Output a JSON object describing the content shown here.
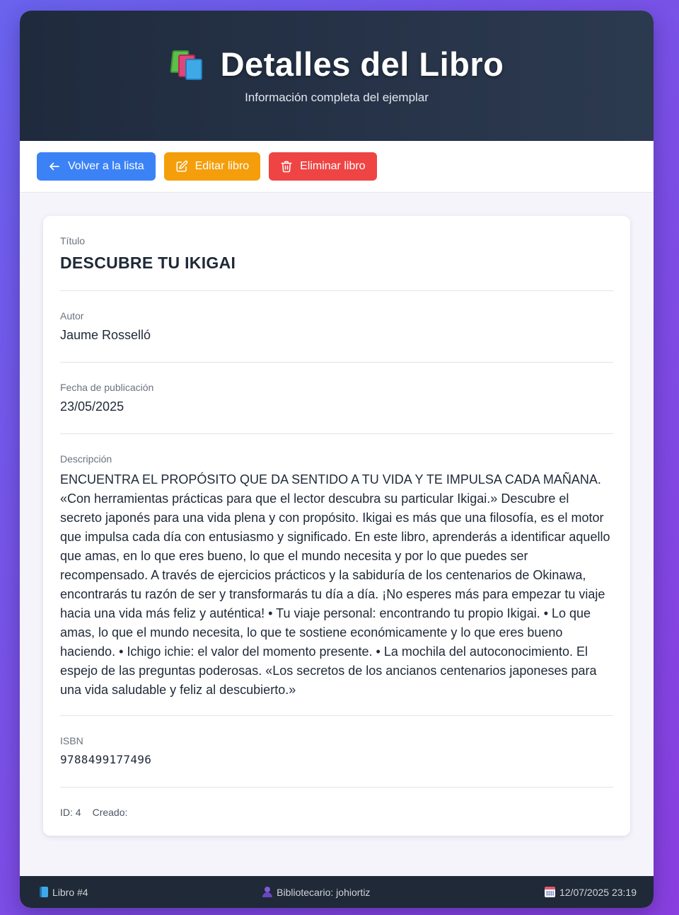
{
  "header": {
    "title": "Detalles del Libro",
    "subtitle": "Información completa del ejemplar",
    "icon": "books-icon"
  },
  "toolbar": {
    "back_label": "Volver a la lista",
    "edit_label": "Editar libro",
    "delete_label": "Eliminar libro",
    "colors": {
      "back": "#3b82f6",
      "edit": "#f59e0b",
      "delete": "#ef4444"
    }
  },
  "book": {
    "title_label": "Título",
    "title": "DESCUBRE TU IKIGAI",
    "author_label": "Autor",
    "author": "Jaume Rosselló",
    "date_label": "Fecha de publicación",
    "date": "23/05/2025",
    "description_label": "Descripción",
    "description": "ENCUENTRA EL PROPÓSITO QUE DA SENTIDO A TU VIDA Y TE IMPULSA CADA MAÑANA. «Con herramientas prácticas para que el lector descubra su particular Ikigai.» Descubre el secreto japonés para una vida plena y con propósito. Ikigai es más que una filosofía, es el motor que impulsa cada día con entusiasmo y significado. En este libro, aprenderás a identificar aquello que amas, en lo que eres bueno, lo que el mundo necesita y por lo que puedes ser recompensado. A través de ejercicios prácticos y la sabiduría de los centenarios de Okinawa, encontrarás tu razón de ser y transformarás tu día a día. ¡No esperes más para empezar tu viaje hacia una vida más feliz y auténtica! • Tu viaje personal: encontrando tu propio Ikigai. • Lo que amas, lo que el mundo necesita, lo que te sostiene económicamente y lo que eres bueno haciendo. • Ichigo ichie: el valor del momento presente. • La mochila del autoconocimiento. El espejo de las preguntas poderosas. «Los secretos de los ancianos centenarios japoneses para una vida saludable y feliz al descubierto.»",
    "isbn_label": "ISBN",
    "isbn": "9788499177496",
    "id_text": "ID: 4",
    "created_text": "Creado:"
  },
  "footer": {
    "book_text": "Libro #4",
    "librarian_text": "Bibliotecario: johiortiz",
    "datetime_text": "12/07/2025 23:19"
  }
}
